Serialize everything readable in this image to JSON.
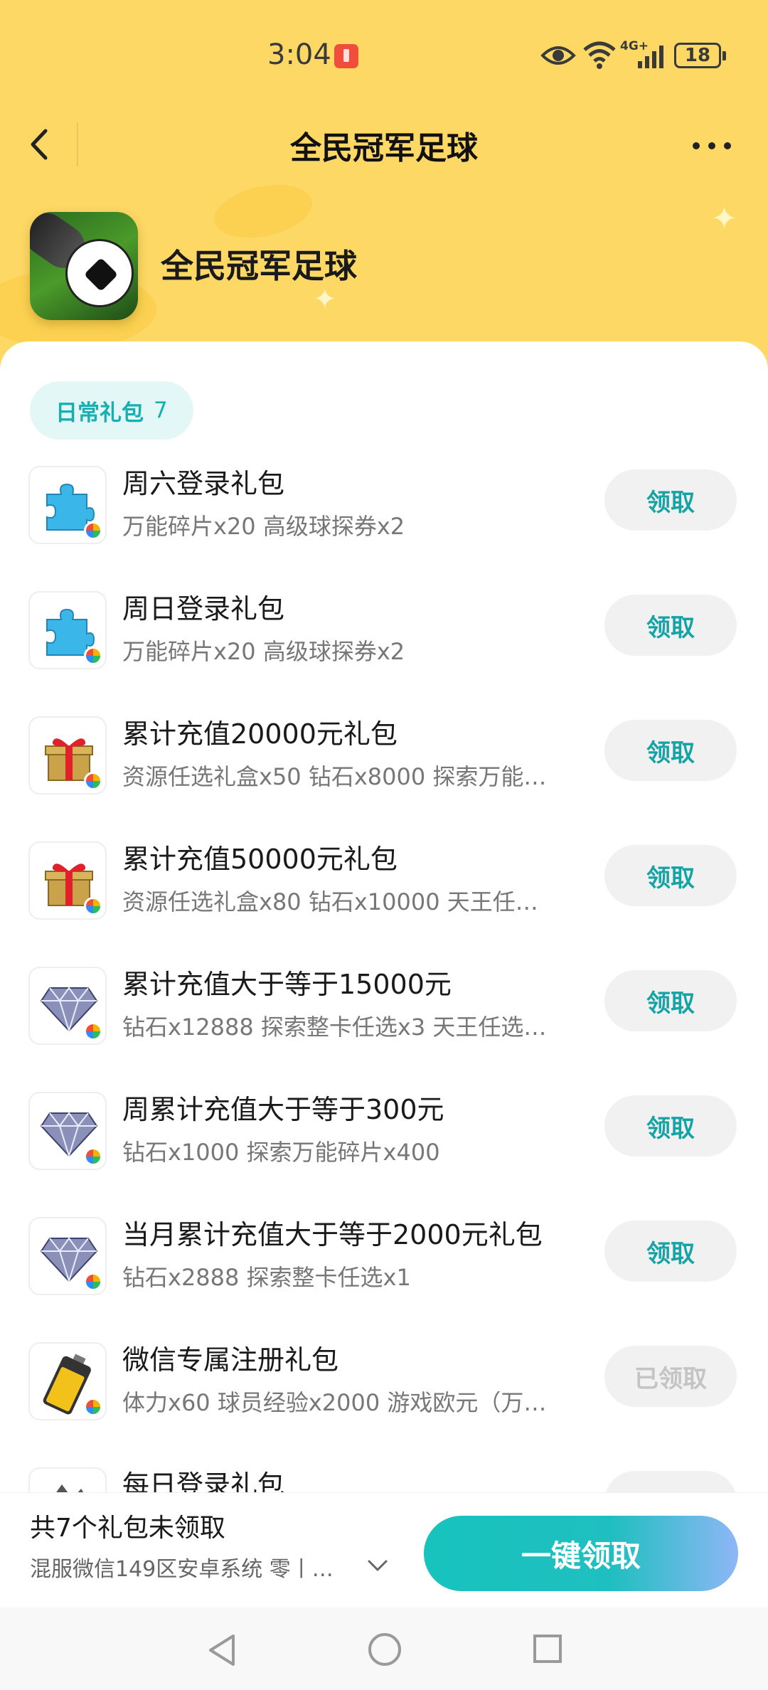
{
  "status_bar": {
    "time": "3:04",
    "network": "4G+",
    "battery": "18"
  },
  "nav": {
    "title": "全民冠军足球"
  },
  "game": {
    "name": "全民冠军足球"
  },
  "tab": {
    "label": "日常礼包",
    "count": "7"
  },
  "gifts": [
    {
      "title": "周六登录礼包",
      "desc": "万能碎片x20 高级球探券x2",
      "button": "领取",
      "icon": "puzzle-icon",
      "claimed": false
    },
    {
      "title": "周日登录礼包",
      "desc": "万能碎片x20 高级球探券x2",
      "button": "领取",
      "icon": "puzzle-icon",
      "claimed": false
    },
    {
      "title": "累计充值20000元礼包",
      "desc": "资源任选礼盒x50 钻石x8000 探索万能…",
      "button": "领取",
      "icon": "gift-box-icon",
      "claimed": false
    },
    {
      "title": "累计充值50000元礼包",
      "desc": "资源任选礼盒x80 钻石x10000 天王任…",
      "button": "领取",
      "icon": "gift-box-icon",
      "claimed": false
    },
    {
      "title": "累计充值大于等于15000元",
      "desc": "钻石x12888 探索整卡任选x3 天王任选…",
      "button": "领取",
      "icon": "diamond-icon",
      "claimed": false
    },
    {
      "title": "周累计充值大于等于300元",
      "desc": "钻石x1000 探索万能碎片x400",
      "button": "领取",
      "icon": "diamond-icon",
      "claimed": false
    },
    {
      "title": "当月累计充值大于等于2000元礼包",
      "desc": "钻石x2888 探索整卡任选x1",
      "button": "领取",
      "icon": "diamond-icon",
      "claimed": false
    },
    {
      "title": "微信专属注册礼包",
      "desc": "体力x60 球员经验x2000 游戏欧元（万…",
      "button": "已领取",
      "icon": "battery-icon",
      "claimed": true
    },
    {
      "title": "每日登录礼包",
      "desc": "",
      "button": "",
      "icon": "gift-icon",
      "claimed": false
    }
  ],
  "bottom": {
    "unclaimed": "共7个礼包未领取",
    "server": "混服微信149区安卓系统 零丨…",
    "claim_all": "一键领取"
  },
  "colors": {
    "header_bg": "#fdd865",
    "accent": "#16b0b3",
    "card_bg": "#ffffff"
  }
}
